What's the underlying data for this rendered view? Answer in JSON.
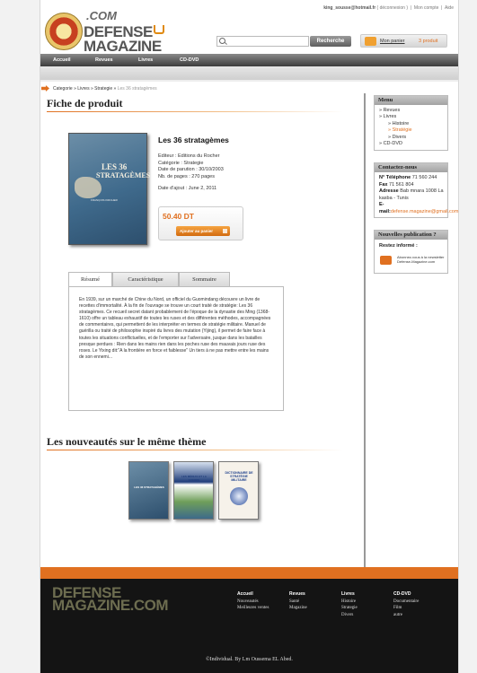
{
  "header": {
    "user_email": "king_sousse@hotmail.fr",
    "logout": "( déconnexion )",
    "account": "Mon compte",
    "help": "Aide",
    "logo_com": ".COM",
    "logo_line1": "DEFENSE",
    "logo_line2": "MAGAZINE",
    "search_placeholder": "",
    "search_button": "Recherche",
    "cart_label": "Mon panier",
    "cart_count": "3 produit"
  },
  "nav": [
    "Accueil",
    "Revues",
    "Livres",
    "CD-DVD"
  ],
  "breadcrumb": {
    "path": "Categorie » Livres » Strategie »",
    "current": "Les 36 stratagèmes"
  },
  "product": {
    "section_title": "Fiche de produit",
    "cover_title_1": "LES 36",
    "cover_title_2": "STRATAGÈMES",
    "cover_author": "FRANÇOIS KIRCHER",
    "title": "Les 36 stratagèmes",
    "editeur": "Editeur : Editions du Rocher",
    "categorie": "Catégorie : Strategie",
    "date_parution": "Date de parution : 30/10/2003",
    "pages": "Nb. de pages : 270 pages",
    "date_ajout": "Date d'ajout : June 2, 2011",
    "price": "50.40 DT",
    "add_to_cart": "Ajouter au panier"
  },
  "tabs": {
    "items": [
      "Résumé",
      "Caractéristique",
      "Sommaire"
    ],
    "resume": "En 1939, sur un marché de Chine du Nord, un officiel du Guomindang découvre un livre de recettes d'immortalité. À la fin de l'ouvrage se trouve un court traité de stratégie: Les 36 stratagèmes. Ce recueil secret datant probablement de l'époque de la dynastie des Ming (1368-1610) offre un tableau exhaustif de toutes les ruses et des différentes méthodes, accompagnées de commentaires, qui permettent de les interpréter en termes de stratégie militaire. Manuel de guérilla ou traité de philosophie inspiré du livres des mutation (Yijing), il permet de faire face à toutes les situations conflictuelles, et de l'emporter sur l'adversaire, jusque dans les batailles presque perdues : Rien dans les mains rien dans les poches ruse des mauvais jours ruse des roses. Le Yixing dit:\"A la frontière en force et faiblesse\" Un tiers à ne pas mettre entre les mains de son ennemi..."
  },
  "related": {
    "section_title": "Les nouveautés sur le même thème",
    "books": [
      {
        "label": "LES 36 STRATAGÈMES"
      },
      {
        "label": "LES MÉDIAS ET LA GUERRE"
      },
      {
        "label": "DICTIONNAIRE DE STRATÉGIE MILITAIRE"
      }
    ]
  },
  "sidebar": {
    "menu_title": "Menu",
    "menu": {
      "revues": "» Revues",
      "livres": "» Livres",
      "histoire": "» Histoire",
      "strategie": "» Stratégie",
      "divers": "» Divers",
      "cddvd": "» CD-DVD"
    },
    "contact_title": "Contactez-nous",
    "contact": {
      "tel_label": "N° Téléphone",
      "tel": "71 560 244",
      "fax_label": "Fax",
      "fax": "71 561 804",
      "adresse_label": "Adresse",
      "adresse": "Bab mnara 1008 La kasba - Tunis",
      "email_label": "E-mail:",
      "email": "defense.magazine@gmail.com"
    },
    "news_title": "Nouvelles publication ?",
    "news_sub": "Restez informé :",
    "news_text": "Abonnez-vous à la newsletter Defense-Magazine.com"
  },
  "footer": {
    "logo_line1": "DEFENSE",
    "logo_line2": "MAGAZINE.COM",
    "columns": [
      {
        "title": "Accueil",
        "items": [
          "Nouveautés",
          "Meilleures ventes"
        ]
      },
      {
        "title": "Revues",
        "items": [
          "Santé",
          "Magazine"
        ]
      },
      {
        "title": "Livres",
        "items": [
          "Histoire",
          "Strategie",
          "Divers"
        ]
      },
      {
        "title": "CD-DVD",
        "items": [
          "Documentaire",
          "Film",
          "autre"
        ]
      }
    ],
    "copyright": "©Individual. By Lm Oussema EL Abed."
  }
}
